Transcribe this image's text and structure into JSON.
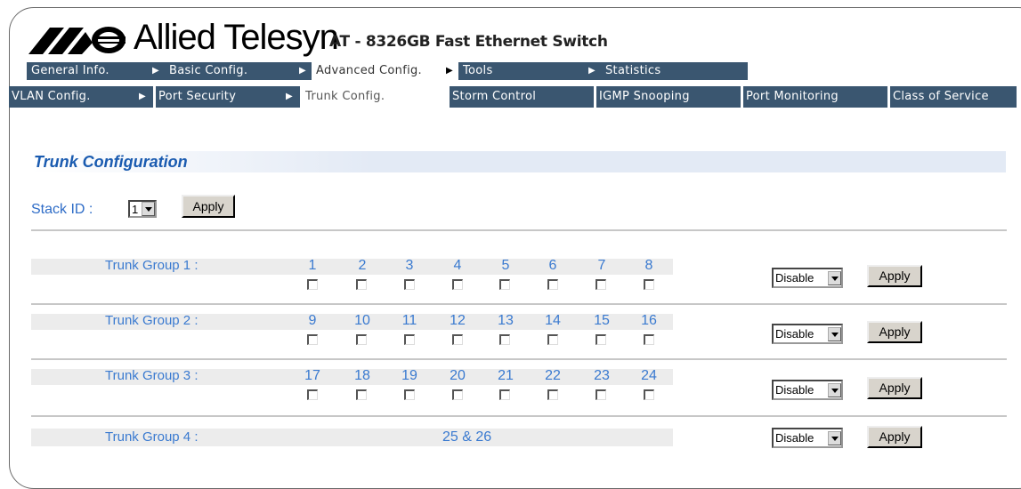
{
  "brand": {
    "logo_text": "Allied Telesyn",
    "model": "AT - 8326GB Fast Ethernet Switch"
  },
  "nav_main": [
    {
      "label": "General Info.",
      "arrow": true,
      "active": false
    },
    {
      "label": "Basic Config.",
      "arrow": true,
      "active": false
    },
    {
      "label": "Advanced Config.",
      "arrow": true,
      "active": true
    },
    {
      "label": "Tools",
      "arrow": true,
      "active": false
    },
    {
      "label": "Statistics",
      "arrow": false,
      "active": false
    }
  ],
  "nav_sub": [
    {
      "label": "VLAN Config.",
      "arrow": true,
      "active": false
    },
    {
      "label": "Port Security",
      "arrow": true,
      "active": false
    },
    {
      "label": "Trunk Config.",
      "arrow": false,
      "active": true
    },
    {
      "label": "Storm Control",
      "arrow": false,
      "active": false
    },
    {
      "label": "IGMP Snooping",
      "arrow": false,
      "active": false
    },
    {
      "label": "Port Monitoring",
      "arrow": false,
      "active": false
    },
    {
      "label": "Class of Service",
      "arrow": false,
      "active": false
    }
  ],
  "page_title": "Trunk Configuration",
  "stack": {
    "label": "Stack ID :",
    "value": "1",
    "apply_label": "Apply"
  },
  "groups": [
    {
      "label": "Trunk Group 1 :",
      "ports": [
        "1",
        "2",
        "3",
        "4",
        "5",
        "6",
        "7",
        "8"
      ],
      "mode": "Disable",
      "apply_label": "Apply"
    },
    {
      "label": "Trunk Group 2 :",
      "ports": [
        "9",
        "10",
        "11",
        "12",
        "13",
        "14",
        "15",
        "16"
      ],
      "mode": "Disable",
      "apply_label": "Apply"
    },
    {
      "label": "Trunk Group 3 :",
      "ports": [
        "17",
        "18",
        "19",
        "20",
        "21",
        "22",
        "23",
        "24"
      ],
      "mode": "Disable",
      "apply_label": "Apply"
    },
    {
      "label": "Trunk Group 4 :",
      "combo_ports": "25 & 26",
      "mode": "Disable",
      "apply_label": "Apply"
    }
  ],
  "colors": {
    "nav_bg": "#3a5670",
    "accent_text": "#3a7ad0",
    "title_blue": "#1a5bb0"
  }
}
